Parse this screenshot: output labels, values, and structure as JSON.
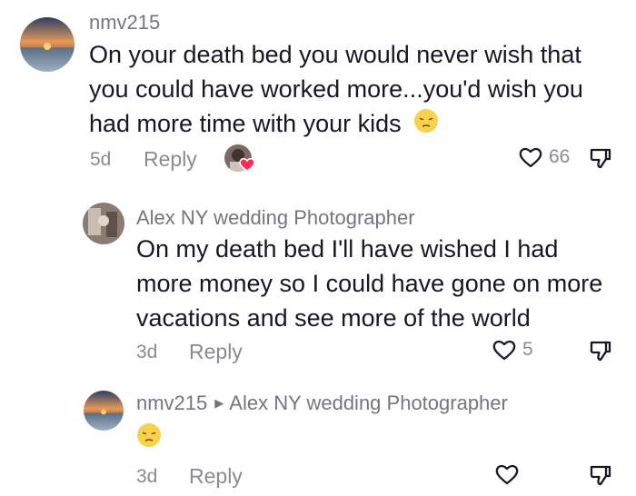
{
  "comments": [
    {
      "username": "nmv215",
      "text": "On your death bed you would never wish that you could have worked more...you'd wish you had more time with your kids",
      "line1": "On your death bed you would never wish that",
      "line2": "you could have worked more...you'd wish you",
      "line3": "had more time with your kids",
      "emoji": "pensive-face",
      "date": "5d",
      "reply_label": "Reply",
      "likes": "66",
      "liked_by_creator": true
    },
    {
      "username": "Alex NY wedding Photographer",
      "line1": "On my death bed I'll have wished I had",
      "line2": "more money so I could have gone on more",
      "line3": "vacations and see more of the world",
      "date": "3d",
      "reply_label": "Reply",
      "likes": "5"
    },
    {
      "username": "nmv215",
      "reply_to": "Alex NY wedding Photographer",
      "emoji": "pensive-face",
      "date": "3d",
      "reply_label": "Reply"
    }
  ],
  "colors": {
    "text_primary": "#161823",
    "text_secondary": "#75767d",
    "creator_heart": "#fe2c55",
    "emoji_yellow": "#f7d24a"
  },
  "icons": [
    "heart-outline-icon",
    "thumbs-down-icon",
    "pensive-face-emoji",
    "creator-heart-badge-icon"
  ]
}
